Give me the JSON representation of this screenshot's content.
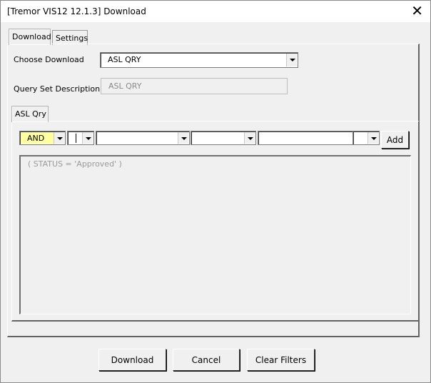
{
  "window": {
    "title": "[Tremor VIS12 12.1.3] Download",
    "close_icon": "close-icon"
  },
  "tabs": [
    {
      "label": "Download",
      "active": true
    },
    {
      "label": "Settings",
      "active": false
    }
  ],
  "form": {
    "choose_download_label": "Choose Download",
    "choose_download_value": "ASL QRY",
    "query_set_description_label": "Query Set Description",
    "query_set_description_value": "ASL QRY"
  },
  "inner_tab": {
    "label": "ASL Qry"
  },
  "filter_row": {
    "logic_value": "AND",
    "operator_value": "",
    "field_value": "",
    "condition_value": "",
    "text_value": "",
    "value_select": "",
    "add_label": "Add",
    "highlight_color": "#ffffa0"
  },
  "query_text": "( STATUS = 'Approved' )",
  "buttons": {
    "download": "Download",
    "cancel": "Cancel",
    "clear_filters": "Clear Filters"
  }
}
